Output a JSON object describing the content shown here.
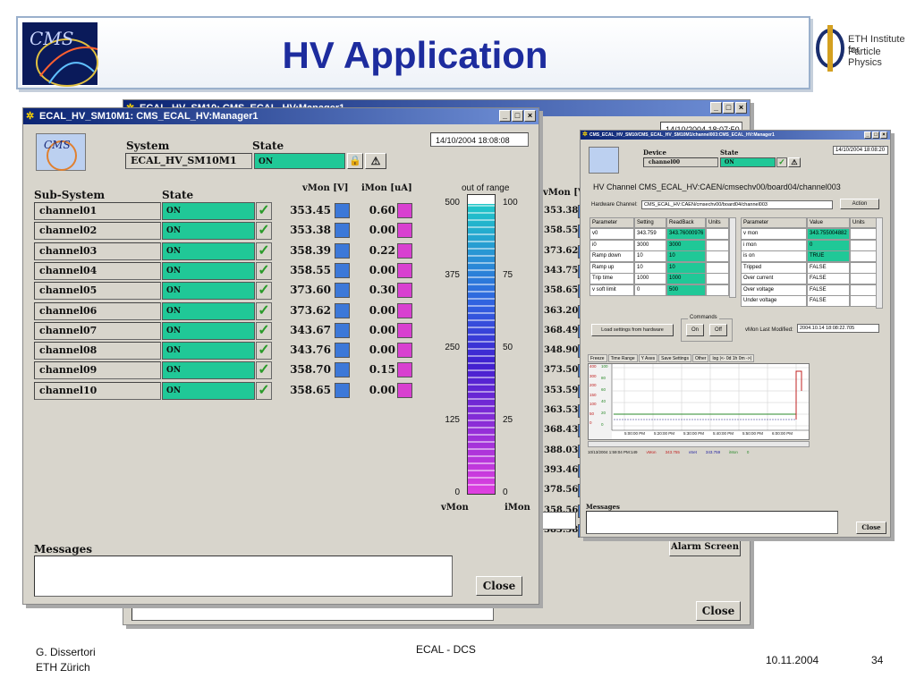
{
  "slide": {
    "title": "HV Application",
    "cms_logo": "CMS",
    "eth_logo_line1": "ETH Institute for",
    "eth_logo_line2": "Particle Physics"
  },
  "back_window": {
    "title": "ECAL_HV_SM10: CMS_ECAL_HV:Manager1",
    "date": "14/10/2004 18:07:50",
    "col_header": "vMon [V]",
    "values": [
      "353.38",
      "358.55",
      "373.62",
      "343.75",
      "358.65",
      "363.20",
      "368.49",
      "348.90",
      "373.50",
      "353.59",
      "363.53",
      "368.43",
      "388.03",
      "393.46",
      "378.56",
      "358.56",
      "383.58"
    ],
    "close_label": "Close",
    "alarm_label": "Alarm Screen"
  },
  "main_window": {
    "title": "ECAL_HV_SM10M1: CMS_ECAL_HV:Manager1",
    "system_label": "System",
    "state_label": "State",
    "system_value": "ECAL_HV_SM10M1",
    "system_state": "ON",
    "date": "14/10/2004  18:08:08",
    "subsystem_label": "Sub-System",
    "subsystem_state_label": "State",
    "vmon_label": "vMon [V]",
    "imon_label": "iMon [uA]",
    "channels": [
      {
        "name": "channel01",
        "state": "ON",
        "vmon": "353.45",
        "imon": "0.60"
      },
      {
        "name": "channel02",
        "state": "ON",
        "vmon": "353.38",
        "imon": "0.00"
      },
      {
        "name": "channel03",
        "state": "ON",
        "vmon": "358.39",
        "imon": "0.22"
      },
      {
        "name": "channel04",
        "state": "ON",
        "vmon": "358.55",
        "imon": "0.00"
      },
      {
        "name": "channel05",
        "state": "ON",
        "vmon": "373.60",
        "imon": "0.30"
      },
      {
        "name": "channel06",
        "state": "ON",
        "vmon": "373.62",
        "imon": "0.00"
      },
      {
        "name": "channel07",
        "state": "ON",
        "vmon": "343.67",
        "imon": "0.00"
      },
      {
        "name": "channel08",
        "state": "ON",
        "vmon": "343.76",
        "imon": "0.00"
      },
      {
        "name": "channel09",
        "state": "ON",
        "vmon": "358.70",
        "imon": "0.15"
      },
      {
        "name": "channel10",
        "state": "ON",
        "vmon": "358.65",
        "imon": "0.00"
      }
    ],
    "scale": {
      "out_of_range": "out of range",
      "vmon_ticks": [
        "500",
        "375",
        "250",
        "125",
        "0"
      ],
      "imon_ticks": [
        "100",
        "75",
        "50",
        "25",
        "0"
      ],
      "vmon_label": "vMon",
      "imon_label": "iMon"
    },
    "messages_label": "Messages",
    "close_label": "Close"
  },
  "channel_window": {
    "title": "CMS_ECAL_HV_SM10/CMS_ECAL_HV_SM10M1/channel003:CMS_ECAL_HV:Manager1",
    "device_label": "Device",
    "state_label": "State",
    "device_value": "channel00",
    "state_value": "ON",
    "date": "14/10/2004  18:08:20",
    "heading": "HV Channel CMS_ECAL_HV:CAEN/cmsechv00/board04/channel003",
    "hw_channel_label": "Hardware Channel:",
    "hw_channel_value": "CMS_ECAL_HV:CAEN/cmsechv00/board04/channel003",
    "action_label": "Action",
    "left_table": {
      "headers": [
        "Parameter",
        "Setting",
        "ReadBack",
        "Units"
      ],
      "rows": [
        [
          "v0",
          "343.759",
          "343.76000976",
          ""
        ],
        [
          "i0",
          "3000",
          "3000",
          ""
        ],
        [
          "Ramp down",
          "10",
          "10",
          ""
        ],
        [
          "Ramp up",
          "10",
          "10",
          ""
        ],
        [
          "Trip time",
          "1000",
          "1000",
          ""
        ],
        [
          "v soft limit",
          "0",
          "500",
          ""
        ]
      ]
    },
    "right_table": {
      "headers": [
        "Parameter",
        "Value",
        "Units"
      ],
      "rows": [
        [
          "v mon",
          "343.755004882",
          ""
        ],
        [
          "i mon",
          "0",
          ""
        ],
        [
          "is on",
          "TRUE",
          ""
        ],
        [
          "Tripped",
          "FALSE",
          ""
        ],
        [
          "Over current",
          "FALSE",
          ""
        ],
        [
          "Over voltage",
          "FALSE",
          ""
        ],
        [
          "Under voltage",
          "FALSE",
          ""
        ]
      ]
    },
    "commands_label": "Commands",
    "load_label": "Load settings from hardware",
    "on_label": "On",
    "off_label": "Off",
    "last_modified_label": "vMon Last Modified:",
    "last_modified_value": "2004.10.14 18:08:22.705",
    "trend_toolbar": [
      "Freeze",
      "Time Range",
      "Y Axes",
      "Save Settings",
      "Other",
      "log |<-  0d 1h 0m  ->|"
    ],
    "trend_y_left": [
      "400",
      "300",
      "200",
      "150",
      "100",
      "50",
      "0"
    ],
    "trend_y_right": [
      "100",
      "80",
      "60",
      "40",
      "20",
      "0"
    ],
    "trend_x": [
      "5:00:00 PM",
      "5:20:00 PM",
      "5:30:00 PM",
      "5:40:00 PM",
      "5:50:00 PM",
      "6:00:00 PM"
    ],
    "trend_legend": [
      "10/13/2004 1:59:04 PM:149",
      "vMon",
      "343.755",
      "vSet",
      "343.759",
      "iMon",
      "0"
    ],
    "messages_label": "Messages",
    "close_label": "Close"
  },
  "footer": {
    "author": "G. Dissertori",
    "institute": "ETH Zürich",
    "center": "ECAL - DCS",
    "date": "10.11.2004",
    "page": "34"
  }
}
